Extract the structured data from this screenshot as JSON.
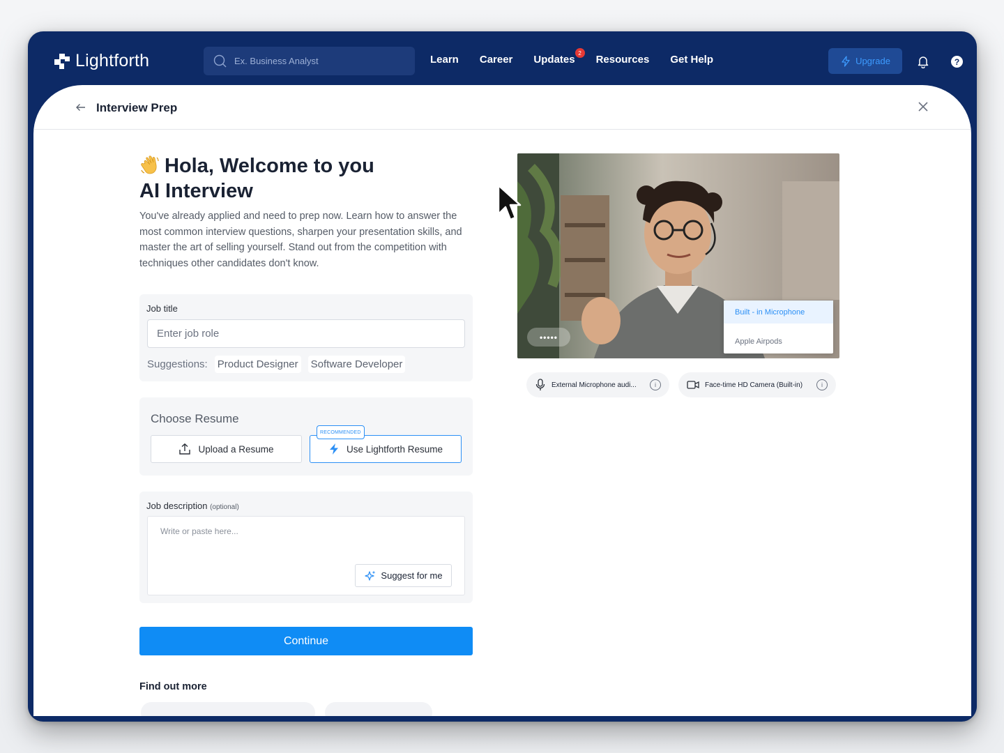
{
  "app": {
    "name": "Lightforth"
  },
  "search": {
    "placeholder": "Ex. Business Analyst"
  },
  "nav": {
    "links": [
      "Learn",
      "Career",
      "Updates",
      "Resources",
      "Get Help"
    ],
    "updates_badge": "2",
    "upgrade_label": "Upgrade",
    "help_glyph": "?"
  },
  "panel": {
    "title": "Interview Prep",
    "hero_line1": "Hola, Welcome to you",
    "hero_line2": "AI Interview",
    "description": "You've already applied and need to prep now. Learn how to answer the most common interview questions, sharpen your presentation skills, and master the art of selling yourself. Stand out from the competition with techniques other candidates don't know."
  },
  "job_title": {
    "label": "Job title",
    "placeholder": "Enter job role",
    "suggestions_label": "Suggestions:",
    "suggestions": [
      "Product Designer",
      "Software Developer"
    ]
  },
  "resume": {
    "title": "Choose Resume",
    "upload_label": "Upload a Resume",
    "lightforth_label": "Use Lightforth Resume",
    "recommended_tag": "RECOMMENDED"
  },
  "job_description": {
    "label": "Job description",
    "optional": "(optional)",
    "placeholder": "Write or paste here...",
    "suggest_label": "Suggest for me"
  },
  "continue_label": "Continue",
  "find_more_title": "Find out more",
  "video": {
    "audio_indicator": "•••••",
    "mic_options": [
      "Built - in Microphone",
      "Apple Airpods"
    ],
    "selected_mic": "Built - in Microphone"
  },
  "devices": {
    "microphone": "External Microphone audi...",
    "camera": "Face-time HD Camera (Built-in)",
    "info_glyph": "i"
  },
  "colors": {
    "nav_bg": "#0d2a66",
    "accent": "#0f8cf5",
    "badge": "#e53935"
  }
}
